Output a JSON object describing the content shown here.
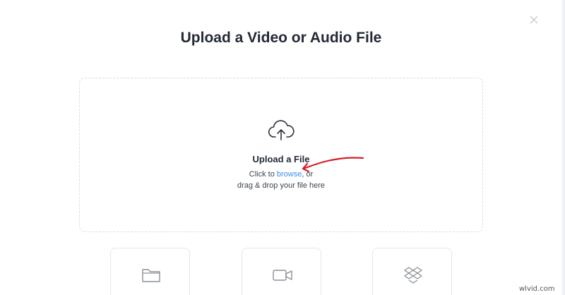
{
  "modal": {
    "title": "Upload a Video or Audio File",
    "close_icon": "close-icon"
  },
  "dropzone": {
    "icon": "cloud-upload-icon",
    "heading": "Upload a File",
    "line1_prefix": "Click to ",
    "browse_label": "browse",
    "line1_suffix": ", or",
    "line2": "drag & drop your file here"
  },
  "sources": [
    {
      "icon": "folder-icon"
    },
    {
      "icon": "video-camera-icon"
    },
    {
      "icon": "dropbox-icon"
    }
  ],
  "watermark": "wlvid.com",
  "colors": {
    "link": "#3b8ee8",
    "annotation": "#d4202a",
    "border": "#d9dde3",
    "text": "#232a35"
  }
}
